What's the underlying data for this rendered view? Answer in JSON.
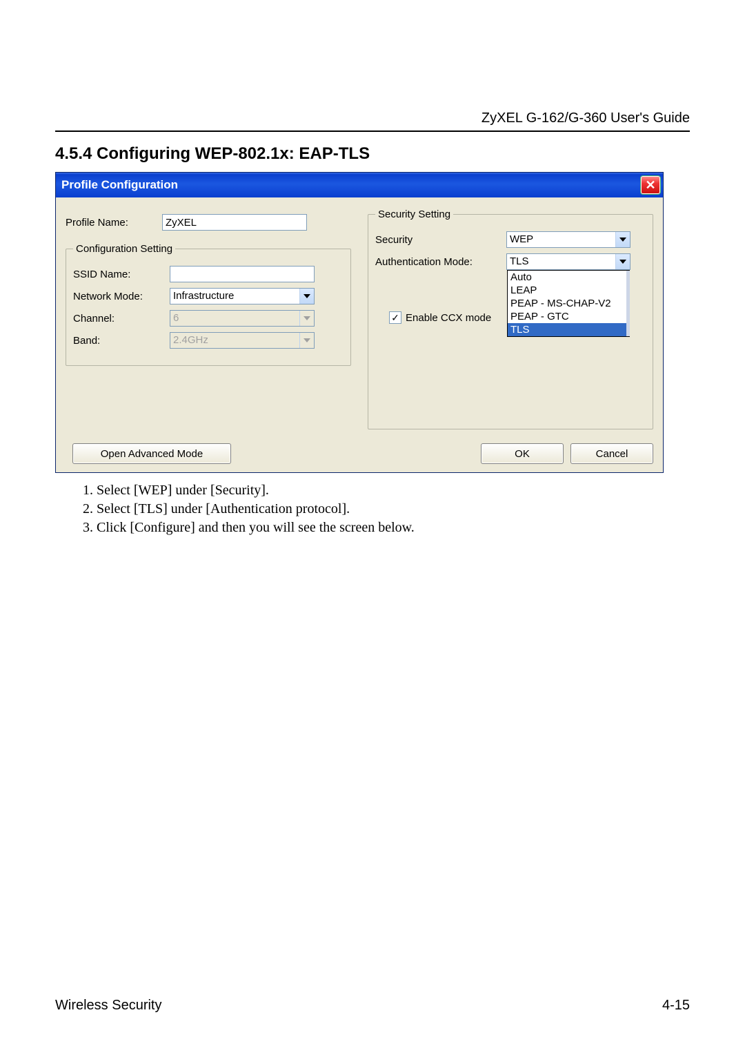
{
  "doc": {
    "header": "ZyXEL G-162/G-360 User's Guide",
    "section_heading": "4.5.4  Configuring WEP-802.1x: EAP-TLS",
    "footer_left": "Wireless Security",
    "footer_right": "4-15"
  },
  "dialog": {
    "title": "Profile Configuration",
    "close_glyph": "✕",
    "profile_name_label": "Profile Name:",
    "profile_name_value": "ZyXEL",
    "config_setting_legend": "Configuration Setting",
    "ssid_label": "SSID Name:",
    "ssid_value": "",
    "network_mode_label": "Network Mode:",
    "network_mode_value": "Infrastructure",
    "channel_label": "Channel:",
    "channel_value": "6",
    "band_label": "Band:",
    "band_value": "2.4GHz",
    "security_setting_legend": "Security Setting",
    "security_label": "Security",
    "security_value": "WEP",
    "auth_mode_label": "Authentication Mode:",
    "auth_mode_value": "TLS",
    "auth_options": [
      "Auto",
      "LEAP",
      "PEAP - MS-CHAP-V2",
      "PEAP - GTC",
      "TLS"
    ],
    "auth_selected": "TLS",
    "ccx_label": "Enable CCX mode",
    "ccx_check": "✓",
    "advanced_button": "Open Advanced Mode",
    "ok_button": "OK",
    "cancel_button": "Cancel"
  },
  "steps": [
    "Select [WEP] under [Security].",
    "Select [TLS] under [Authentication protocol].",
    "Click [Configure] and then you will see the screen below."
  ]
}
